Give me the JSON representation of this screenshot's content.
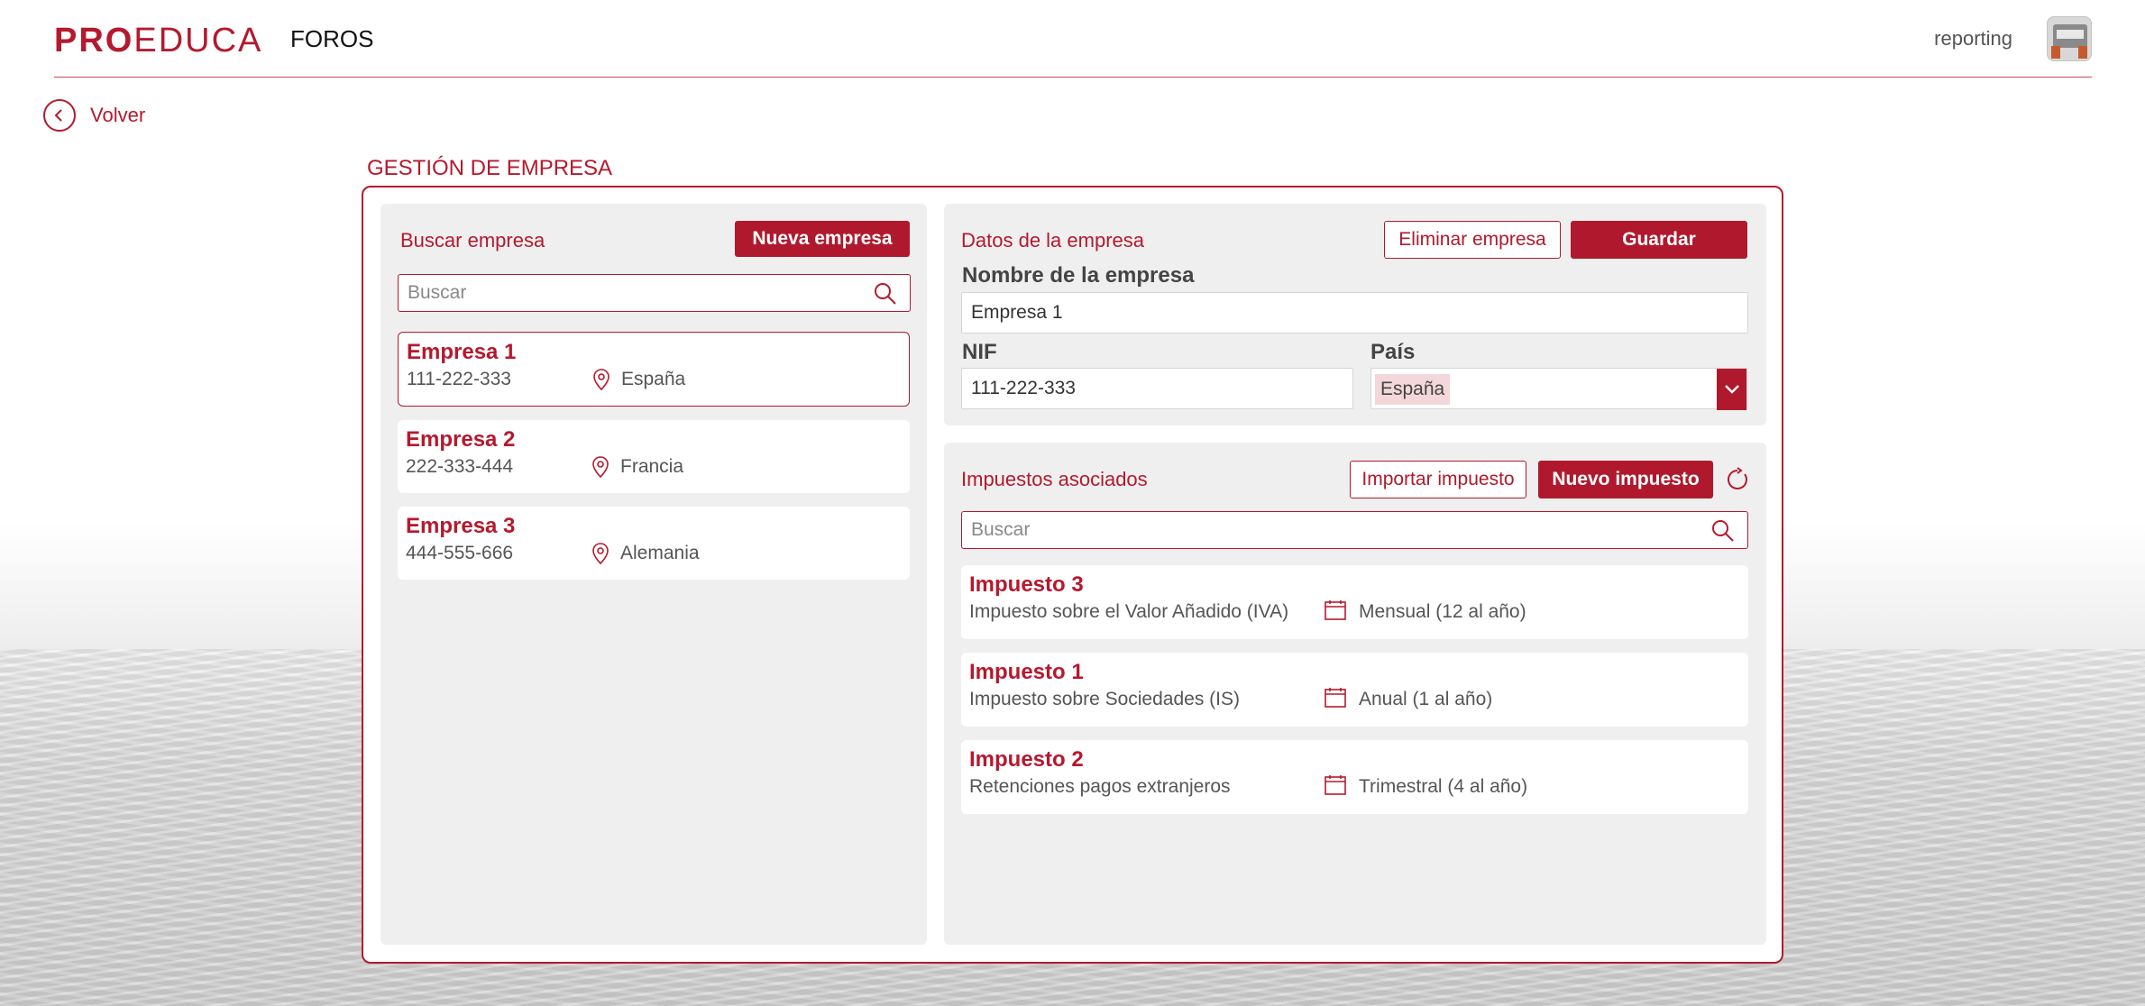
{
  "header": {
    "logo_bold": "PRO",
    "logo_light": "EDUCA",
    "app_name": "FOROS",
    "user_name": "reporting"
  },
  "back": {
    "label": "Volver"
  },
  "section_title": "GESTIÓN DE EMPRESA",
  "left_panel": {
    "title": "Buscar empresa",
    "new_button": "Nueva empresa",
    "search_placeholder": "Buscar",
    "companies": [
      {
        "name": "Empresa 1",
        "nif": "111-222-333",
        "country": "España",
        "selected": true
      },
      {
        "name": "Empresa 2",
        "nif": "222-333-444",
        "country": "Francia",
        "selected": false
      },
      {
        "name": "Empresa 3",
        "nif": "444-555-666",
        "country": "Alemania",
        "selected": false
      }
    ]
  },
  "company_data": {
    "title": "Datos de la empresa",
    "delete_button": "Eliminar empresa",
    "save_button": "Guardar",
    "name_label": "Nombre de la empresa",
    "name_value": "Empresa 1",
    "nif_label": "NIF",
    "nif_value": "111-222-333",
    "country_label": "País",
    "country_value": "España"
  },
  "taxes": {
    "title": "Impuestos asociados",
    "import_button": "Importar impuesto",
    "new_button": "Nuevo impuesto",
    "search_placeholder": "Buscar",
    "items": [
      {
        "name": "Impuesto 3",
        "description": "Impuesto sobre el Valor Añadido (IVA)",
        "periodicity": "Mensual (12 al año)"
      },
      {
        "name": "Impuesto 1",
        "description": "Impuesto sobre Sociedades (IS)",
        "periodicity": "Anual (1 al año)"
      },
      {
        "name": "Impuesto 2",
        "description": "Retenciones pagos extranjeros",
        "periodicity": "Trimestral (4 al año)"
      }
    ]
  },
  "colors": {
    "brand": "#b5192e",
    "panel_bg": "#efefef",
    "chip_bg": "#f3d7da"
  },
  "icons": {
    "back": "chevron-left-circle-icon",
    "search": "search-icon",
    "location": "map-pin-icon",
    "calendar": "calendar-icon",
    "dropdown": "chevron-down-icon",
    "refresh": "refresh-icon"
  }
}
